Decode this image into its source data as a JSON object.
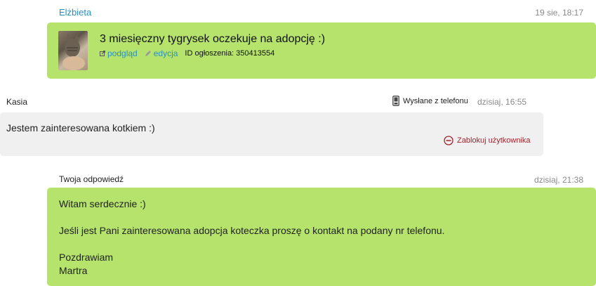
{
  "message1": {
    "sender": "Elżbieta",
    "time": "19 sie, 18:17",
    "ad": {
      "thumb_icon": "cat-photo",
      "title": "3 miesięczny tygrysek oczekuje na adopcję :)",
      "preview_label": "podgląd",
      "edit_label": "edycja",
      "id_label": "ID ogłoszenia: 350413554"
    }
  },
  "message2": {
    "sender": "Kasia",
    "sent_from": "Wysłane z telefonu",
    "time": "dzisiaj, 16:55",
    "text": "Jestem zainteresowana kotkiem :)",
    "block_label": "Zablokuj użytkownika"
  },
  "message3": {
    "header": "Twoja odpowiedź",
    "time": "dzisiaj, 21:38",
    "text": "Witam serdecznie :)\n\nJeśli jest Pani zainteresowana adopcja koteczka proszę o kontakt na podany nr telefonu.\n\nPozdrawiam\nMartra"
  },
  "colors": {
    "green_bubble": "#b5e36b",
    "grey_bubble": "#f0f0f0",
    "link": "#2a8fbd",
    "block": "#a3232d"
  }
}
